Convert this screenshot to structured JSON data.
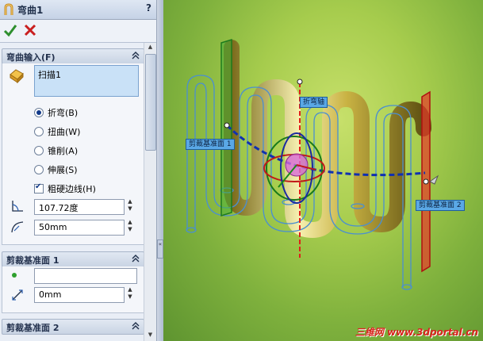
{
  "panel": {
    "title": "弯曲1",
    "help": "?",
    "ok_label": "OK",
    "cancel_label": "Cancel"
  },
  "bend_input": {
    "header": "弯曲输入(F)",
    "selected_body": "扫描1",
    "options": [
      {
        "label": "折弯(B)",
        "selected": true
      },
      {
        "label": "扭曲(W)",
        "selected": false
      },
      {
        "label": "锥削(A)",
        "selected": false
      },
      {
        "label": "伸展(S)",
        "selected": false
      }
    ],
    "hard_edges": {
      "label": "粗硬边线(H)",
      "checked": true
    },
    "angle": "107.72度",
    "radius": "50mm"
  },
  "trim_plane_1": {
    "header": "剪裁基准面 1",
    "reference": "",
    "distance": "0mm"
  },
  "trim_plane_2": {
    "header": "剪裁基准面 2"
  },
  "viewport": {
    "tags": {
      "bend_axis": "折弯轴",
      "trim_plane_1": "剪裁基准面 1",
      "trim_plane_2": "剪裁基准面 2"
    },
    "watermark": "三维网 www.3dportal.cn"
  },
  "colors": {
    "accent": "#123a8a",
    "trim_plane_1": "#3aa63a",
    "trim_plane_2": "#e02020",
    "selection": "#c9e1f7"
  }
}
